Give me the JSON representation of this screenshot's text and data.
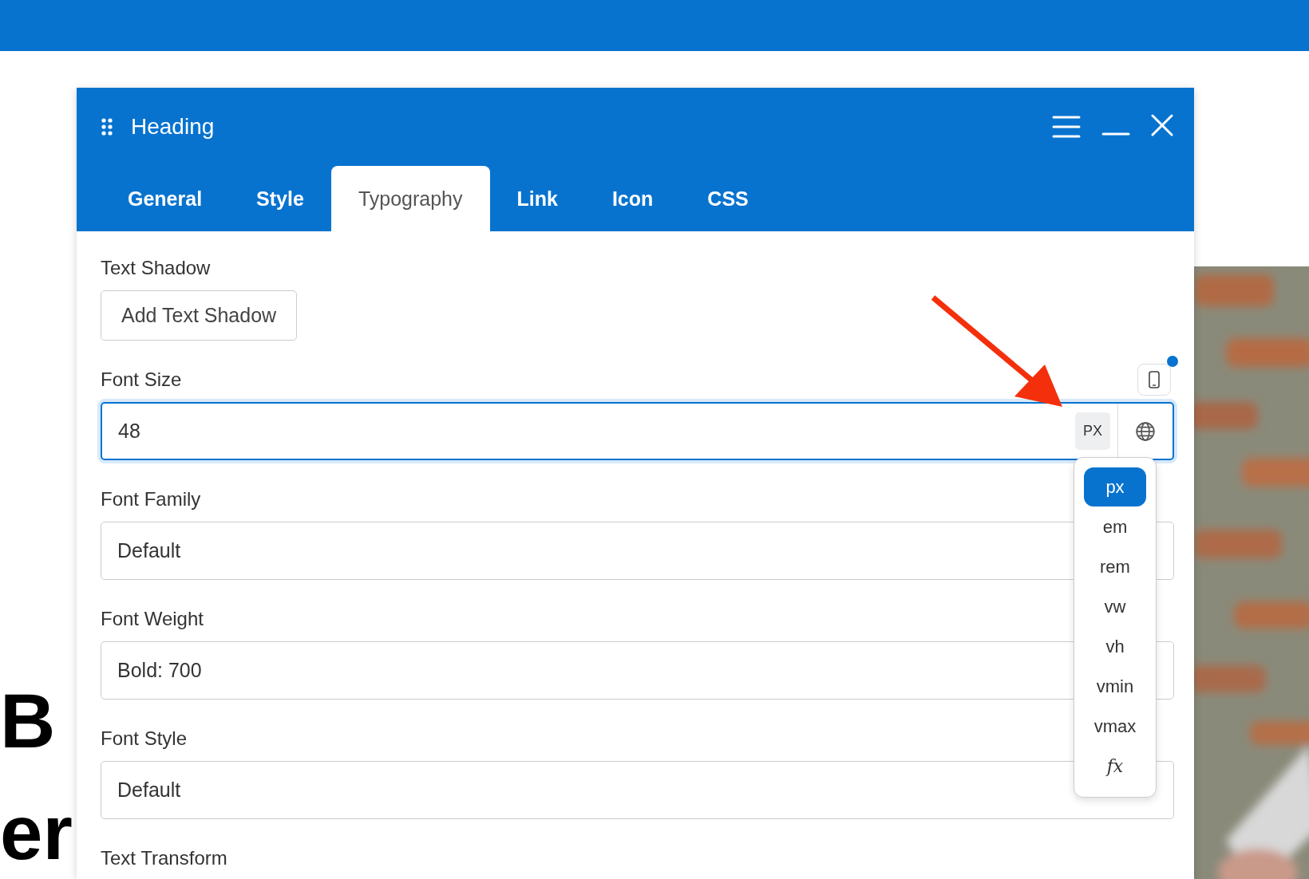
{
  "page": {
    "heading_fragments": [
      "B",
      "er"
    ]
  },
  "panel": {
    "title": "Heading",
    "tabs": [
      {
        "label": "General",
        "selected": false
      },
      {
        "label": "Style",
        "selected": false
      },
      {
        "label": "Typography",
        "selected": true
      },
      {
        "label": "Link",
        "selected": false
      },
      {
        "label": "Icon",
        "selected": false
      },
      {
        "label": "CSS",
        "selected": false
      }
    ],
    "fields": [
      {
        "kind": "button",
        "label": "Text Shadow",
        "button": "Add Text Shadow"
      },
      {
        "kind": "unit-input",
        "label": "Font Size",
        "value": "48",
        "unit": "PX",
        "units": [
          {
            "label": "px",
            "selected": true
          },
          {
            "label": "em",
            "selected": false
          },
          {
            "label": "rem",
            "selected": false
          },
          {
            "label": "vw",
            "selected": false
          },
          {
            "label": "vh",
            "selected": false
          },
          {
            "label": "vmin",
            "selected": false
          },
          {
            "label": "vmax",
            "selected": false
          },
          {
            "label": "fx",
            "selected": false
          }
        ]
      },
      {
        "kind": "select",
        "label": "Font Family",
        "value": "Default"
      },
      {
        "kind": "select",
        "label": "Font Weight",
        "value": "Bold: 700"
      },
      {
        "kind": "select",
        "label": "Font Style",
        "value": "Default"
      },
      {
        "kind": "select",
        "label": "Text Transform"
      }
    ]
  }
}
